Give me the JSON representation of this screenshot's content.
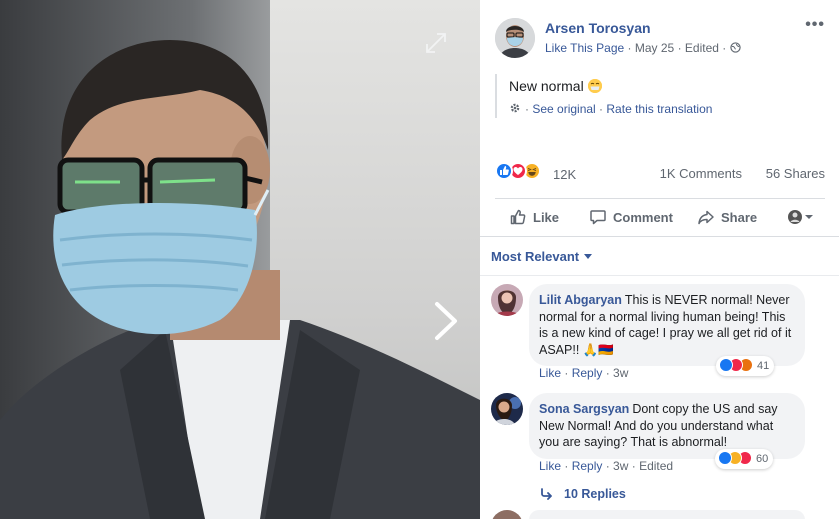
{
  "post": {
    "author": "Arsen Torosyan",
    "like_page": "Like This Page",
    "date": "May 25",
    "edited": "Edited",
    "text": "New normal",
    "see_original": "See original",
    "rate_translation": "Rate this translation",
    "reaction_count": "12K",
    "comments_count": "1K Comments",
    "shares_count": "56 Shares"
  },
  "actions": {
    "like": "Like",
    "comment": "Comment",
    "share": "Share"
  },
  "sort_label": "Most Relevant",
  "comments": [
    {
      "name": "Lilit Abgaryan",
      "text": "This is NEVER normal! Never normal for a normal living human being! This is a new kind of cage! I pray we all get rid of it ASAP!! 🙏🇦🇲",
      "reaction_count": "41",
      "like": "Like",
      "reply": "Reply",
      "time": "3w"
    },
    {
      "name": "Sona Sargsyan",
      "text": "Dont copy the US and say New Normal! And do you understand what you are saying? That is abnormal!",
      "reaction_count": "60",
      "like": "Like",
      "reply": "Reply",
      "time": "3w",
      "edited": "Edited"
    }
  ],
  "replies_label": "10 Replies",
  "colors": {
    "link": "#385898",
    "meta": "#606770",
    "bubble": "#f2f3f5",
    "like_blue": "#1877f2",
    "love_red": "#f0284a",
    "haha_yellow": "#f7b125",
    "angry_orange": "#e9710f"
  },
  "icons": [
    "expand-icon",
    "chevron-right-icon",
    "globe-icon",
    "more-icon",
    "gear-icon",
    "like-icon",
    "comment-icon",
    "share-icon",
    "reply-arrow-icon"
  ]
}
